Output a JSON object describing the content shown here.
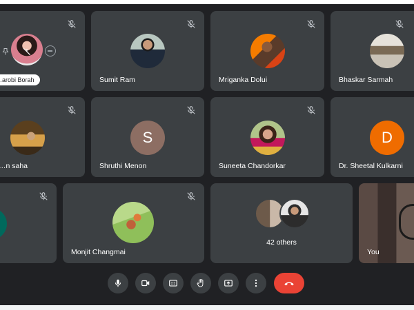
{
  "participants": [
    {
      "name": "…arobi Borah",
      "avatar": "photo-woman",
      "muted": true
    },
    {
      "name": "Sumit Ram",
      "avatar": "photo-man-suit",
      "muted": true
    },
    {
      "name": "Mriganka Dolui",
      "avatar": "photo-man",
      "muted": true
    },
    {
      "name": "Bhaskar Sarmah",
      "avatar": "photo-room",
      "muted": true
    },
    {
      "name": "…n saha",
      "avatar": "photo-man-sitting",
      "muted": true
    },
    {
      "name": "Shruthi Menon",
      "avatar_letter": "S",
      "avatar_color": "#8d6e63",
      "muted": true
    },
    {
      "name": "Suneeta Chandorkar",
      "avatar": "photo-woman-glasses",
      "muted": true
    },
    {
      "name": "Dr. Sheetal Kulkarni",
      "avatar_letter": "D",
      "avatar_color": "#ef6c00",
      "muted": false
    },
    {
      "name": "",
      "avatar": "teal-partial",
      "muted": true
    },
    {
      "name": "Monjit Changmai",
      "avatar": "photo-hummingbird",
      "muted": true
    }
  ],
  "others": {
    "label": "42 others"
  },
  "self": {
    "label": "You"
  },
  "controls": {
    "mic": "mic-icon",
    "camera": "camera-icon",
    "captions": "captions-icon",
    "raise_hand": "hand-icon",
    "present": "present-icon",
    "more": "more-vert-icon",
    "end_call": "call-end-icon",
    "end_call_color": "#ea4335"
  }
}
